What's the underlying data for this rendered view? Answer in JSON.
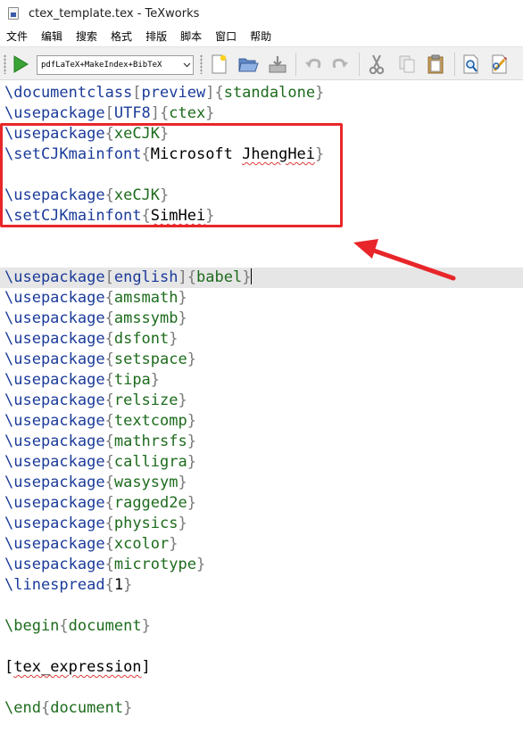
{
  "window": {
    "title": "ctex_template.tex - TeXworks"
  },
  "menu": [
    "文件",
    "编辑",
    "搜索",
    "格式",
    "排版",
    "脚本",
    "窗口",
    "帮助"
  ],
  "toolbar": {
    "typeset_engine": "pdfLaTeX+MakeIndex+BibTeX",
    "icons": [
      "typeset-play-icon",
      "new-document-icon",
      "open-folder-icon",
      "save-icon",
      "undo-icon",
      "redo-icon",
      "cut-icon",
      "copy-icon",
      "paste-icon",
      "find-icon",
      "replace-icon"
    ],
    "colors": {
      "play": "#3aa335",
      "highlight": "#e8262a"
    }
  },
  "editor": {
    "lines": [
      [
        {
          "t": "\\documentclass",
          "c": "cmd"
        },
        {
          "t": "[",
          "c": "brk"
        },
        {
          "t": "preview",
          "c": "opt"
        },
        {
          "t": "]",
          "c": "brk"
        },
        {
          "t": "{",
          "c": "brk"
        },
        {
          "t": "standalone",
          "c": "arg"
        },
        {
          "t": "}",
          "c": "brk"
        }
      ],
      [
        {
          "t": "\\usepackage",
          "c": "cmd"
        },
        {
          "t": "[",
          "c": "brk"
        },
        {
          "t": "UTF8",
          "c": "opt"
        },
        {
          "t": "]",
          "c": "brk"
        },
        {
          "t": "{",
          "c": "brk"
        },
        {
          "t": "ctex",
          "c": "arg"
        },
        {
          "t": "}",
          "c": "brk"
        }
      ],
      [
        {
          "t": "\\usepackage",
          "c": "cmd"
        },
        {
          "t": "{",
          "c": "brk"
        },
        {
          "t": "xeCJK",
          "c": "arg"
        },
        {
          "t": "}",
          "c": "brk"
        }
      ],
      [
        {
          "t": "\\setCJKmainfont",
          "c": "cmd"
        },
        {
          "t": "{",
          "c": "brk"
        },
        {
          "t": "Microsoft ",
          "c": "plain"
        },
        {
          "t": "JhengHei",
          "c": "plain",
          "spell": true
        },
        {
          "t": "}",
          "c": "brk"
        }
      ],
      [],
      [
        {
          "t": "\\usepackage",
          "c": "cmd"
        },
        {
          "t": "{",
          "c": "brk"
        },
        {
          "t": "xeCJK",
          "c": "arg"
        },
        {
          "t": "}",
          "c": "brk"
        }
      ],
      [
        {
          "t": "\\setCJKmainfont",
          "c": "cmd"
        },
        {
          "t": "{",
          "c": "brk"
        },
        {
          "t": "SimHei",
          "c": "plain",
          "spell": true
        },
        {
          "t": "}",
          "c": "brk"
        }
      ],
      [],
      [],
      [
        {
          "t": "\\usepackage",
          "c": "cmd"
        },
        {
          "t": "[",
          "c": "brk"
        },
        {
          "t": "english",
          "c": "opt"
        },
        {
          "t": "]",
          "c": "brk"
        },
        {
          "t": "{",
          "c": "brk"
        },
        {
          "t": "babel",
          "c": "arg"
        },
        {
          "t": "}",
          "c": "brk"
        }
      ],
      [
        {
          "t": "\\usepackage",
          "c": "cmd"
        },
        {
          "t": "{",
          "c": "brk"
        },
        {
          "t": "amsmath",
          "c": "arg"
        },
        {
          "t": "}",
          "c": "brk"
        }
      ],
      [
        {
          "t": "\\usepackage",
          "c": "cmd"
        },
        {
          "t": "{",
          "c": "brk"
        },
        {
          "t": "amssymb",
          "c": "arg"
        },
        {
          "t": "}",
          "c": "brk"
        }
      ],
      [
        {
          "t": "\\usepackage",
          "c": "cmd"
        },
        {
          "t": "{",
          "c": "brk"
        },
        {
          "t": "dsfont",
          "c": "arg"
        },
        {
          "t": "}",
          "c": "brk"
        }
      ],
      [
        {
          "t": "\\usepackage",
          "c": "cmd"
        },
        {
          "t": "{",
          "c": "brk"
        },
        {
          "t": "setspace",
          "c": "arg"
        },
        {
          "t": "}",
          "c": "brk"
        }
      ],
      [
        {
          "t": "\\usepackage",
          "c": "cmd"
        },
        {
          "t": "{",
          "c": "brk"
        },
        {
          "t": "tipa",
          "c": "arg"
        },
        {
          "t": "}",
          "c": "brk"
        }
      ],
      [
        {
          "t": "\\usepackage",
          "c": "cmd"
        },
        {
          "t": "{",
          "c": "brk"
        },
        {
          "t": "relsize",
          "c": "arg"
        },
        {
          "t": "}",
          "c": "brk"
        }
      ],
      [
        {
          "t": "\\usepackage",
          "c": "cmd"
        },
        {
          "t": "{",
          "c": "brk"
        },
        {
          "t": "textcomp",
          "c": "arg"
        },
        {
          "t": "}",
          "c": "brk"
        }
      ],
      [
        {
          "t": "\\usepackage",
          "c": "cmd"
        },
        {
          "t": "{",
          "c": "brk"
        },
        {
          "t": "mathrsfs",
          "c": "arg"
        },
        {
          "t": "}",
          "c": "brk"
        }
      ],
      [
        {
          "t": "\\usepackage",
          "c": "cmd"
        },
        {
          "t": "{",
          "c": "brk"
        },
        {
          "t": "calligra",
          "c": "arg"
        },
        {
          "t": "}",
          "c": "brk"
        }
      ],
      [
        {
          "t": "\\usepackage",
          "c": "cmd"
        },
        {
          "t": "{",
          "c": "brk"
        },
        {
          "t": "wasysym",
          "c": "arg"
        },
        {
          "t": "}",
          "c": "brk"
        }
      ],
      [
        {
          "t": "\\usepackage",
          "c": "cmd"
        },
        {
          "t": "{",
          "c": "brk"
        },
        {
          "t": "ragged2e",
          "c": "arg"
        },
        {
          "t": "}",
          "c": "brk"
        }
      ],
      [
        {
          "t": "\\usepackage",
          "c": "cmd"
        },
        {
          "t": "{",
          "c": "brk"
        },
        {
          "t": "physics",
          "c": "arg"
        },
        {
          "t": "}",
          "c": "brk"
        }
      ],
      [
        {
          "t": "\\usepackage",
          "c": "cmd"
        },
        {
          "t": "{",
          "c": "brk"
        },
        {
          "t": "xcolor",
          "c": "arg"
        },
        {
          "t": "}",
          "c": "brk"
        }
      ],
      [
        {
          "t": "\\usepackage",
          "c": "cmd"
        },
        {
          "t": "{",
          "c": "brk"
        },
        {
          "t": "microtype",
          "c": "arg"
        },
        {
          "t": "}",
          "c": "brk"
        }
      ],
      [
        {
          "t": "\\linespread",
          "c": "cmd"
        },
        {
          "t": "{",
          "c": "brk"
        },
        {
          "t": "1",
          "c": "plain"
        },
        {
          "t": "}",
          "c": "brk"
        }
      ],
      [],
      [
        {
          "t": "\\begin",
          "c": "arg"
        },
        {
          "t": "{",
          "c": "brk"
        },
        {
          "t": "document",
          "c": "arg"
        },
        {
          "t": "}",
          "c": "brk"
        }
      ],
      [],
      [
        {
          "t": "[",
          "c": "plain"
        },
        {
          "t": "tex_expression",
          "c": "plain",
          "spell": true
        },
        {
          "t": "]",
          "c": "plain"
        }
      ],
      [],
      [
        {
          "t": "\\end",
          "c": "arg"
        },
        {
          "t": "{",
          "c": "brk"
        },
        {
          "t": "document",
          "c": "arg"
        },
        {
          "t": "}",
          "c": "brk"
        }
      ]
    ],
    "active_line_index": 9
  }
}
